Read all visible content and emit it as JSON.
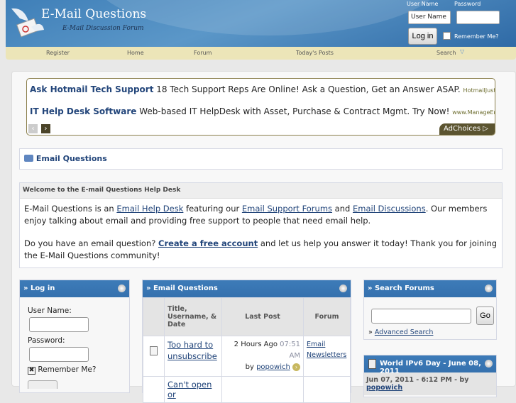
{
  "header": {
    "title": "E-Mail Questions",
    "subtitle": "E-Mail Discussion Forum",
    "username_label": "User Name",
    "password_label": "Password",
    "username_value": "User Name",
    "login_button": "Log in",
    "remember_label": "Remember Me?"
  },
  "nav": {
    "items": [
      "Register",
      "Home",
      "Forum",
      "Today's Posts",
      "Search"
    ]
  },
  "ad": {
    "lines": [
      {
        "title": "Ask Hotmail Tech Support",
        "text": "18 Tech Support Reps Are Online! Ask a Question, Get an Answer ASAP.",
        "url": "HotmailJust..."
      },
      {
        "title": "IT Help Desk Software",
        "text": "Web-based IT HelpDesk with Asset, Purchase & Contract Mgmt. Try Now!",
        "url": "www.ManageEngi..."
      }
    ],
    "adchoices": "AdChoices"
  },
  "breadcrumb": "Email Questions",
  "welcome": {
    "title": "Welcome to the E-mail Questions Help Desk",
    "p1_a": "E-Mail Questions is an ",
    "link1": "Email Help Desk",
    "p1_b": " featuring our ",
    "link2": "Email Support Forums",
    "p1_c": " and ",
    "link3": "Email Discussions",
    "p1_d": ". Our members enjoy talking about email and providing free support to people that need email help.",
    "p2_a": "Do you have an email question? ",
    "link4": "Create a free account",
    "p2_b": " and let us help you answer it today! Thank you for joining the E-Mail Questions community!"
  },
  "login_block": {
    "title": "» Log in",
    "username_label": "User Name:",
    "password_label": "Password:",
    "remember_label": "Remember Me?"
  },
  "questions_block": {
    "title": "» Email Questions",
    "columns": [
      "Title, Username, & Date",
      "Last Post",
      "Forum"
    ],
    "rows": [
      {
        "title": "Too hard to unsubscribe",
        "last_post": "2 Hours Ago",
        "time": "07:51 AM",
        "by": "by",
        "user": "popowich",
        "forum": "Email Newsletters"
      },
      {
        "title": "Can't open or"
      }
    ]
  },
  "search_block": {
    "title": "» Search Forums",
    "go": "Go",
    "advanced_prefix": "»",
    "advanced": "Advanced Search"
  },
  "news_block": {
    "title": "World IPv6 Day - June 08, 2011",
    "meta": "Jun 07, 2011 - 6:12 PM - by",
    "user": "popowich"
  }
}
